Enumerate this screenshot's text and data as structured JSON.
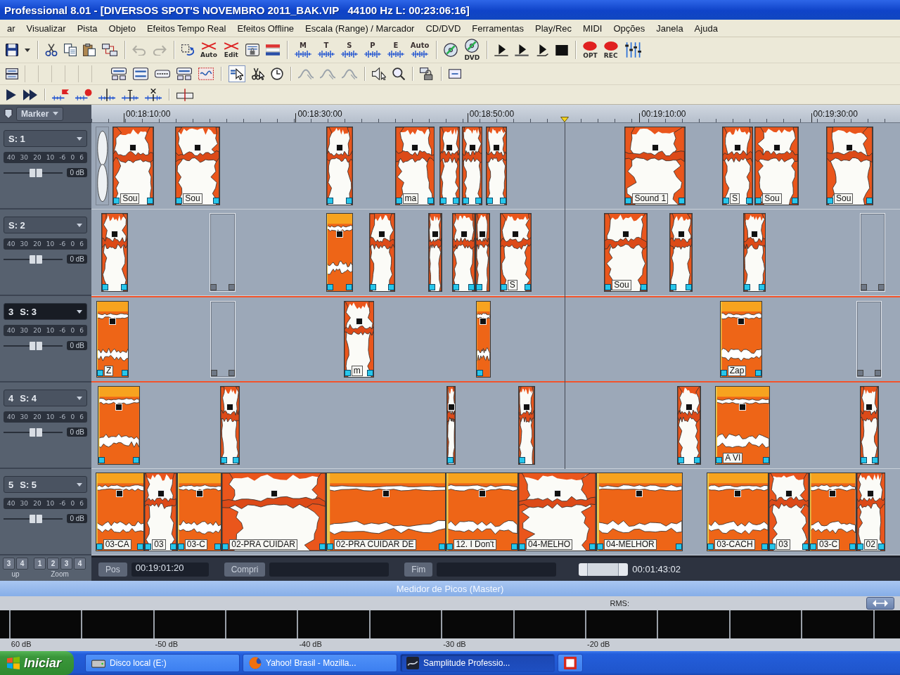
{
  "window": {
    "title": "Professional 8.01 - [DIVERSOS SPOT'S NOVEMBRO 2011_BAK.VIP   44100 Hz L: 00:23:06:16]"
  },
  "menu": [
    "ar",
    "Visualizar",
    "Pista",
    "Objeto",
    "Efeitos Tempo Real",
    "Efeitos Offline",
    "Escala (Range) / Marcador",
    "CD/DVD",
    "Ferramentas",
    "Play/Rec",
    "MIDI",
    "Opções",
    "Janela",
    "Ajuda"
  ],
  "toolbar": {
    "history": [
      {
        "disabled": true
      },
      {
        "disabled": true
      }
    ],
    "edit_modes": [
      "Auto",
      "Edit"
    ],
    "track_modes": [
      "M",
      "T",
      "S",
      "P",
      "E",
      "Auto"
    ],
    "disc_buttons": [
      "DVD"
    ],
    "record_buttons": [
      "OPT",
      "REC"
    ],
    "mouse_modes": [
      {
        "selected": true
      },
      {
        "selected": false
      },
      {
        "selected": false
      }
    ]
  },
  "ruler": {
    "marker_menu": "Marker",
    "labels": [
      "00:18:10:00",
      "00:18:30:00",
      "00:18:50:00",
      "00:19:10:00",
      "00:19:30:00"
    ]
  },
  "tracks": [
    {
      "name": "S: 1",
      "selected": false,
      "scale": "40 30 20 10 -6 0 6",
      "level": 0.55,
      "reading": "0 dB",
      "clips": [
        {
          "kind": "faded"
        },
        {
          "kind": "sparse",
          "label": "Sou"
        },
        {
          "kind": "sparse",
          "label": "Sou"
        },
        {
          "kind": "sparse"
        },
        {
          "kind": "sparse",
          "label": "ma"
        },
        {
          "kind": "sparse"
        },
        {
          "kind": "sparse"
        },
        {
          "kind": "sparse"
        },
        {
          "kind": "sparse",
          "label": "Sound 1"
        },
        {
          "kind": "sparse",
          "label": "S"
        },
        {
          "kind": "sparse",
          "label": "Sou"
        },
        {
          "kind": "sparse",
          "label": "Sou"
        }
      ]
    },
    {
      "name": "S: 2",
      "selected": false,
      "scale": "40 30 20 10 -6 0 6",
      "level": 0.55,
      "reading": "0 dB",
      "clips": [
        {
          "kind": "sparse"
        },
        {
          "kind": "empty"
        },
        {
          "kind": "dense"
        },
        {
          "kind": "sparse"
        },
        {
          "kind": "sparse"
        },
        {
          "kind": "sparse"
        },
        {
          "kind": "sparse"
        },
        {
          "kind": "sparse",
          "label": "S"
        },
        {
          "kind": "sparse",
          "label": "Sou"
        },
        {
          "kind": "sparse"
        },
        {
          "kind": "sparse"
        },
        {
          "kind": "empty"
        }
      ]
    },
    {
      "number": "3",
      "name": "S: 3",
      "selected": true,
      "scale": "40 30 20 10 -6 0 6",
      "level": 0.55,
      "reading": "0 dB",
      "clips": [
        {
          "kind": "dense",
          "label": "Z"
        },
        {
          "kind": "empty"
        },
        {
          "kind": "sparse",
          "label": "m"
        },
        {
          "kind": "dense"
        },
        {
          "kind": "dense",
          "label": "Zap"
        },
        {
          "kind": "empty"
        }
      ]
    },
    {
      "number": "4",
      "name": "S: 4",
      "selected": false,
      "scale": "40 30 20 10 -6 0 6",
      "level": 0.55,
      "reading": "0 dB",
      "clips": [
        {
          "kind": "dense"
        },
        {
          "kind": "sparse"
        },
        {
          "kind": "sparse"
        },
        {
          "kind": "sparse"
        },
        {
          "kind": "sparse"
        },
        {
          "kind": "dense",
          "label": "A VI"
        },
        {
          "kind": "sparse"
        }
      ]
    },
    {
      "number": "5",
      "name": "S: 5",
      "selected": false,
      "scale": "40 30 20 10 -6 0 6",
      "level": 0.55,
      "reading": "0 dB",
      "clips": [
        {
          "kind": "dense",
          "label": "03-CA"
        },
        {
          "kind": "sparse",
          "label": "03"
        },
        {
          "kind": "dense",
          "label": "03-C"
        },
        {
          "kind": "sparse",
          "label": "02-PRA CUIDAR"
        },
        {
          "kind": "dense",
          "label": "02-PRA CUIDAR DE"
        },
        {
          "kind": "dense",
          "label": "12. I Don't"
        },
        {
          "kind": "sparse",
          "label": "04-MELHO"
        },
        {
          "kind": "dense",
          "label": "04-MELHOR"
        },
        {
          "kind": "dense",
          "label": "03-CACH"
        },
        {
          "kind": "sparse",
          "label": "03"
        },
        {
          "kind": "dense",
          "label": "03-C"
        },
        {
          "kind": "sparse",
          "label": "02"
        }
      ]
    }
  ],
  "button_groups": [
    {
      "buttons": [
        "3",
        "4"
      ],
      "label": "up"
    },
    {
      "buttons": [
        "1",
        "2",
        "3",
        "4"
      ],
      "label": "Zoom"
    }
  ],
  "position_bar": {
    "fields": [
      {
        "label": "Pos",
        "value": "00:19:01:20"
      },
      {
        "label": "Compri"
      },
      {
        "label": "Fim"
      }
    ],
    "range_length": "00:01:43:02"
  },
  "peak_meter": {
    "title": "Medidor de Picos (Master)",
    "rms_label": "RMS:",
    "scale": [
      "60 dB",
      "-50 dB",
      "-40 dB",
      "-30 dB",
      "-20 dB"
    ]
  },
  "taskbar": {
    "start_button": "Iniciar",
    "items": [
      {
        "kind": "drive",
        "label": "Disco local (E:)",
        "selected": false
      },
      {
        "kind": "browser",
        "label": "Yahoo! Brasil - Mozilla...",
        "selected": false
      },
      {
        "kind": "app",
        "label": "Samplitude Professio...",
        "selected": true
      },
      {
        "kind": "document",
        "selected": false
      }
    ]
  }
}
